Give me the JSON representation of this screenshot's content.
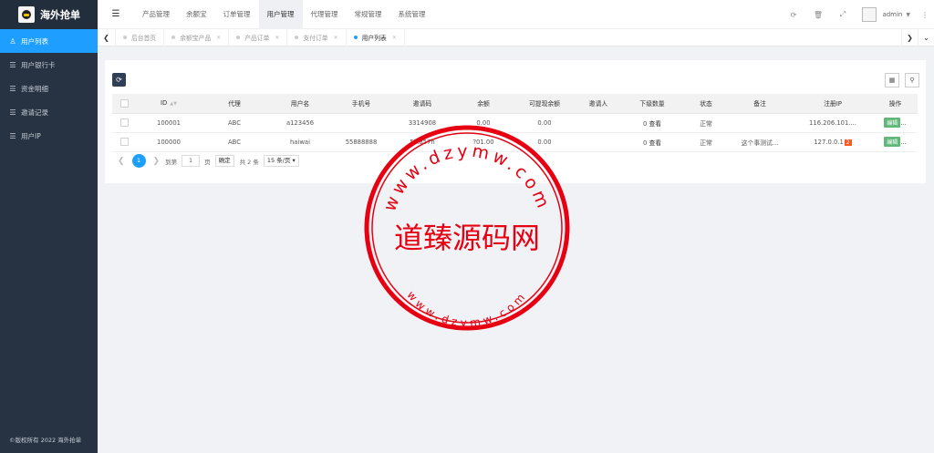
{
  "brand": {
    "name": "海外抢单"
  },
  "sidebar": {
    "items": [
      {
        "label": "用户列表",
        "icon": "users-icon",
        "active": true
      },
      {
        "label": "用户银行卡",
        "icon": "list-icon"
      },
      {
        "label": "资金明细",
        "icon": "list-icon"
      },
      {
        "label": "邀请记录",
        "icon": "list-icon"
      },
      {
        "label": "用户IP",
        "icon": "list-icon"
      }
    ],
    "copyright": "©版权所有 2022 海外抢单"
  },
  "topnav": {
    "items": [
      "产品管理",
      "余额宝",
      "订单管理",
      "用户管理",
      "代理管理",
      "常规管理",
      "系统管理"
    ],
    "active_index": 3,
    "user": "admin"
  },
  "tabs": [
    {
      "label": "后台首页",
      "closable": false
    },
    {
      "label": "余额宝产品",
      "closable": true
    },
    {
      "label": "产品订单",
      "closable": true
    },
    {
      "label": "支付订单",
      "closable": true
    },
    {
      "label": "用户列表",
      "closable": true,
      "active": true
    }
  ],
  "table": {
    "columns": [
      "ID",
      "代理",
      "用户名",
      "手机号",
      "邀请码",
      "余额",
      "可提现余额",
      "邀请人",
      "下级数量",
      "状态",
      "备注",
      "注册IP",
      "操作"
    ],
    "rows": [
      {
        "id": "100001",
        "agent": "ABC",
        "username": "a123456",
        "phone": "",
        "invite_code": "3314908",
        "balance": "0.00",
        "withdrawable": "0.00",
        "inviter": "",
        "subordinates": "0",
        "view": "查看",
        "status": "正常",
        "remark": "",
        "ip": "116.206.101....",
        "ip_badge": "",
        "action": "编辑",
        "more": "..."
      },
      {
        "id": "100000",
        "agent": "ABC",
        "username": "haiwai",
        "phone": "55888888",
        "invite_code": "5?.857n",
        "balance": "?01.00",
        "withdrawable": "0.00",
        "inviter": "",
        "subordinates": "0",
        "view": "查看",
        "status": "正常",
        "remark": "这个事测试...",
        "ip": "127.0.0.1",
        "ip_badge": "2",
        "action": "编辑",
        "more": "..."
      }
    ]
  },
  "pager": {
    "current_page": "1",
    "goto_label": "到第",
    "page_input": "1",
    "page_unit": "页",
    "go_button": "确定",
    "total": "共 2 条",
    "page_size": "15 条/页"
  },
  "watermark": {
    "center_text": "道臻源码网",
    "ring_top": "www.dzymw.com",
    "ring_bottom": "www.dzymw.com",
    "color": "#e60012"
  },
  "colors": {
    "accent": "#1e9fff",
    "sidebar": "#273343",
    "edit": "#5fb878",
    "badge": "#ff5722"
  }
}
